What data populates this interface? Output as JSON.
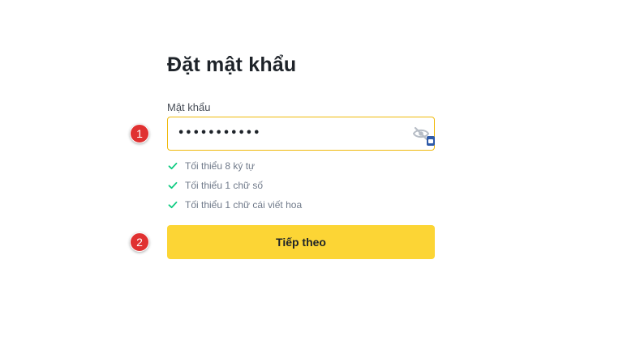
{
  "form": {
    "title": "Đặt mật khẩu",
    "password_label": "Mật khẩu",
    "password_value": "•••••••••••",
    "requirements": [
      {
        "text": "Tối thiểu 8 ký tự",
        "met": true
      },
      {
        "text": "Tối thiểu 1 chữ số",
        "met": true
      },
      {
        "text": "Tối thiểu 1 chữ cái viết hoa",
        "met": true
      }
    ],
    "next_label": "Tiếp theo"
  },
  "annotations": {
    "step1": "1",
    "step2": "2"
  },
  "icons": {
    "visibility_toggle": "eye-slash-icon",
    "requirement_check": "check-icon",
    "password_manager": "password-manager-icon"
  },
  "colors": {
    "accent_yellow": "#fcd535",
    "input_focus_border": "#f0b90b",
    "check_green": "#0ecb81",
    "annotation_red": "#e03131"
  }
}
